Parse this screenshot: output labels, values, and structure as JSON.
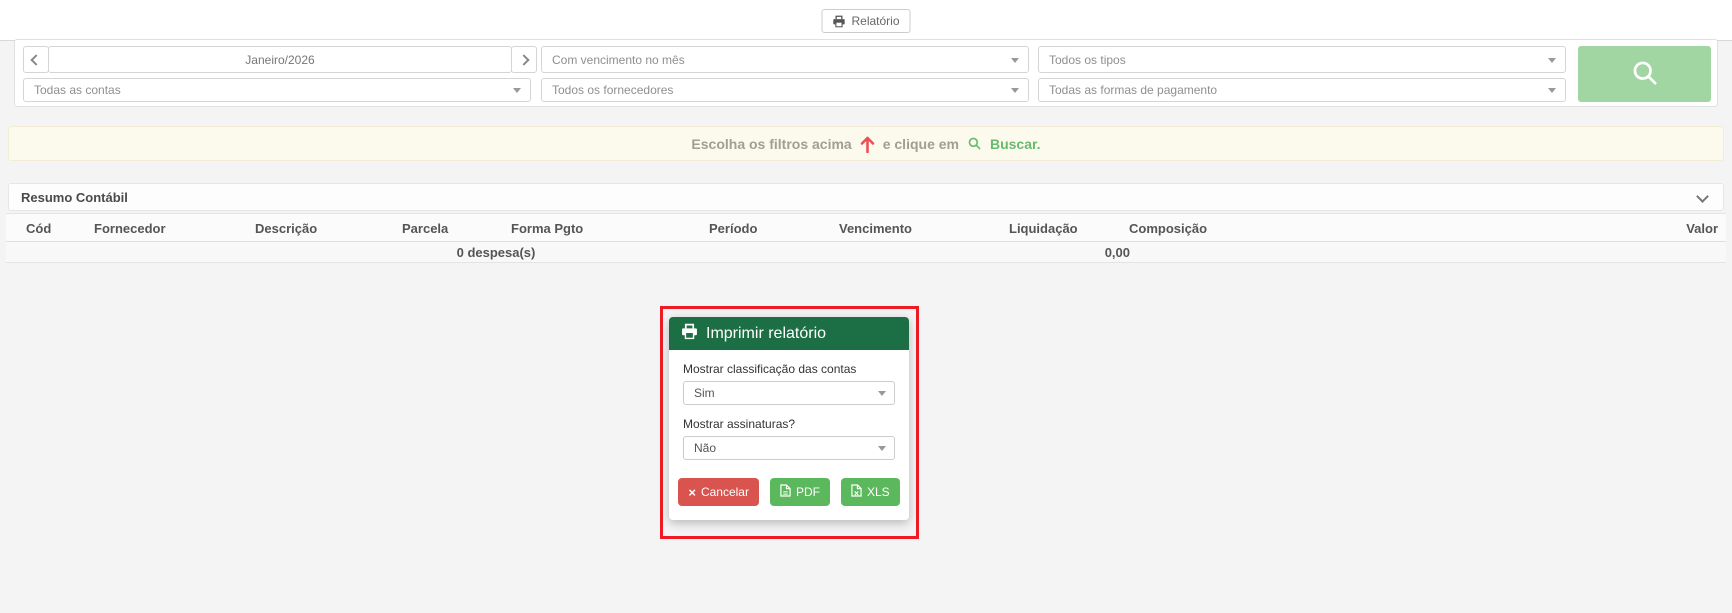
{
  "toolbar": {
    "report_button": "Relatório"
  },
  "filters": {
    "period": "Janeiro/2026",
    "due_filter": "Com vencimento no mês",
    "type_filter": "Todos os tipos",
    "accounts_filter": "Todas as contas",
    "suppliers_filter": "Todos os fornecedores",
    "payment_filter": "Todas as formas de pagamento"
  },
  "notice": {
    "part1": "Escolha os filtros acima",
    "part2": "e clique em",
    "buscar": "Buscar."
  },
  "summary": {
    "title": "Resumo Contábil"
  },
  "table": {
    "headers": [
      "Cód",
      "Fornecedor",
      "Descrição",
      "Parcela",
      "Forma Pgto",
      "Período",
      "Vencimento",
      "Liquidação",
      "Composição",
      "Valor"
    ],
    "totals": {
      "count": "0 despesa(s)",
      "value": "0,00"
    }
  },
  "modal": {
    "title": "Imprimir relatório",
    "field1_label": "Mostrar classificação das contas",
    "field1_value": "Sim",
    "field2_label": "Mostrar assinaturas?",
    "field2_value": "Não",
    "cancel_label": "Cancelar",
    "pdf_label": "PDF",
    "xls_label": "XLS"
  },
  "colors": {
    "modal_header_green": "#1c6f45",
    "button_danger_red": "#d9534f",
    "button_success_green": "#5cb85c",
    "search_button_green": "#a1d6a2",
    "notice_green": "#67bb6c",
    "annotation_red": "#ee1b24",
    "notice_bg_yellow": "#fcfaec"
  }
}
